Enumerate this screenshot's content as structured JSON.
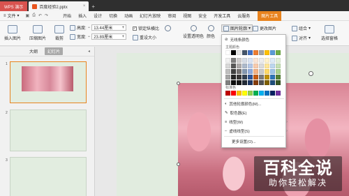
{
  "titlebar": {
    "app": "WPS 演示",
    "doc": "百度经验2.pptx"
  },
  "menu": {
    "file": "文件",
    "tabs": [
      "开始",
      "插入",
      "设计",
      "切换",
      "动画",
      "幻灯片放映",
      "审阅",
      "视图",
      "安全",
      "开发工具",
      "云服务"
    ],
    "tool_tab": "图片工具"
  },
  "ribbon": {
    "insert_picture": "插入图片",
    "compress_picture": "压缩图片",
    "crop": "裁剪",
    "height_label": "高度:",
    "height_value": "13.44厘米",
    "width_label": "宽度:",
    "width_value": "23.89厘米",
    "lock_ratio": "锁定纵横比",
    "reset_size": "重设大小",
    "set_transparent": "设置透明色",
    "color": "颜色",
    "picture_outline": "图片轮廓",
    "change_picture": "更改图片",
    "combine": "组合",
    "align": "对齐",
    "selection_pane": "选择窗格"
  },
  "left_panel": {
    "tab_outline": "大纲",
    "tab_slides": "幻灯片",
    "slide_numbers": [
      "1",
      "2",
      "3"
    ]
  },
  "dropdown": {
    "no_line": "无线条颜色",
    "theme_colors": "主题颜色",
    "standard_colors": "标准色",
    "more_colors": "其他轮廓颜色(M)...",
    "eyedropper": "取色器(E)",
    "weight": "线型(W)",
    "dash": "虚线线型(S)",
    "more_settings": "更多设置(O)...",
    "theme_grid": [
      [
        "#ffffff",
        "#000000",
        "#e7e6e6",
        "#44546a",
        "#4472c4",
        "#ed7d31",
        "#a5a5a5",
        "#ffc000",
        "#5b9bd5",
        "#70ad47"
      ],
      [
        "#f2f2f2",
        "#7f7f7f",
        "#d0cece",
        "#d6dce5",
        "#dae3f3",
        "#fbe5d6",
        "#ededed",
        "#fff2cc",
        "#deebf7",
        "#e2f0d9"
      ],
      [
        "#d9d9d9",
        "#595959",
        "#aeabab",
        "#adb9ca",
        "#b4c7e7",
        "#f8cbad",
        "#dbdbdb",
        "#ffe699",
        "#bdd7ee",
        "#c5e0b4"
      ],
      [
        "#bfbfbf",
        "#404040",
        "#757171",
        "#8497b0",
        "#8faadc",
        "#f4b183",
        "#c9c9c9",
        "#ffd966",
        "#9dc3e6",
        "#a9d18e"
      ],
      [
        "#a6a6a6",
        "#262626",
        "#3b3838",
        "#333f50",
        "#2f5597",
        "#c55a11",
        "#7b7b7b",
        "#bf9000",
        "#2e75b6",
        "#548235"
      ],
      [
        "#7f7f7f",
        "#0d0d0d",
        "#171717",
        "#222a35",
        "#1f3864",
        "#843c0c",
        "#525252",
        "#7f6000",
        "#1f4e79",
        "#385723"
      ]
    ],
    "standard_grid": [
      "#c00000",
      "#ff0000",
      "#ffc000",
      "#ffff00",
      "#92d050",
      "#00b050",
      "#00b0f0",
      "#0070c0",
      "#002060",
      "#7030a0"
    ]
  },
  "watermark": {
    "main": "百科全说",
    "sub": "助你轻松解决"
  }
}
